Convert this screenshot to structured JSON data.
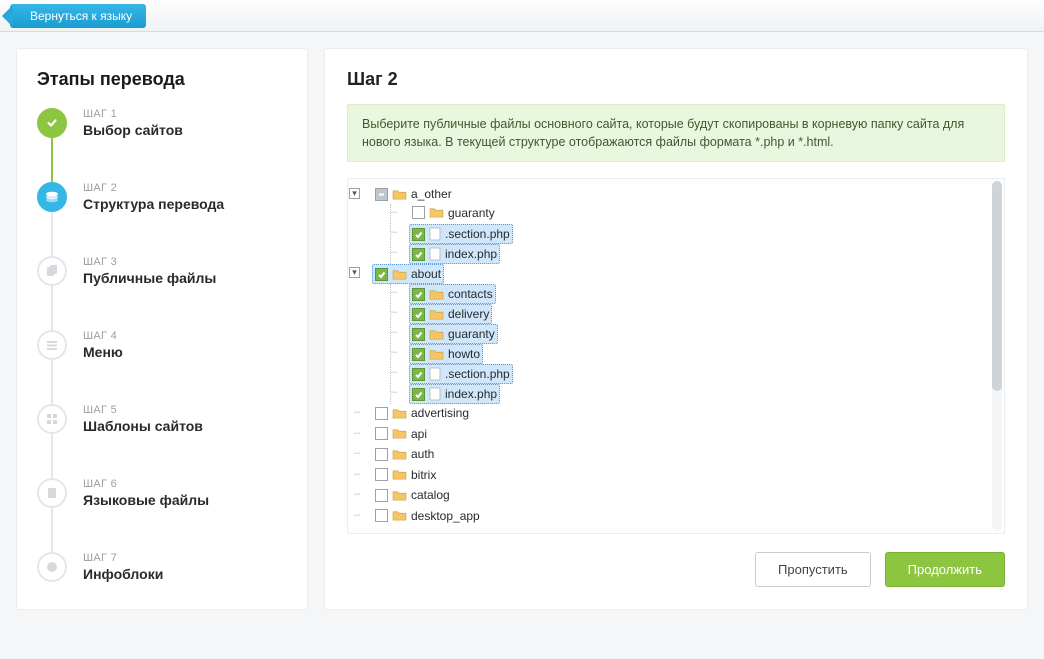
{
  "topbar": {
    "back_label": "Вернуться к языку"
  },
  "sidebar": {
    "title": "Этапы перевода",
    "steps": [
      {
        "kicker": "ШАГ 1",
        "label": "Выбор сайтов"
      },
      {
        "kicker": "ШАГ 2",
        "label": "Структура перевода"
      },
      {
        "kicker": "ШАГ 3",
        "label": "Публичные файлы"
      },
      {
        "kicker": "ШАГ 4",
        "label": "Меню"
      },
      {
        "kicker": "ШАГ 5",
        "label": "Шаблоны сайтов"
      },
      {
        "kicker": "ШАГ 6",
        "label": "Языковые файлы"
      },
      {
        "kicker": "ШАГ 7",
        "label": "Инфоблоки"
      }
    ]
  },
  "main": {
    "title": "Шаг 2",
    "info": "Выберите публичные файлы основного сайта, которые будут скопированы в корневую папку сайта для нового языка. В текущей структуре отображаются файлы формата *.php и *.html.",
    "tree": {
      "a_other": {
        "label": "a_other",
        "state": "mixed",
        "type": "folder",
        "guaranty": {
          "label": "guaranty",
          "state": "unchecked",
          "type": "folder"
        },
        "section_php": {
          "label": ".section.php",
          "state": "checked",
          "type": "file",
          "selected": true
        },
        "index_php": {
          "label": "index.php",
          "state": "checked",
          "type": "file",
          "selected": true
        }
      },
      "about": {
        "label": "about",
        "state": "checked",
        "type": "folder",
        "selected": true,
        "contacts": {
          "label": "contacts",
          "state": "checked",
          "type": "folder",
          "selected": true
        },
        "delivery": {
          "label": "delivery",
          "state": "checked",
          "type": "folder",
          "selected": true
        },
        "guaranty": {
          "label": "guaranty",
          "state": "checked",
          "type": "folder",
          "selected": true
        },
        "howto": {
          "label": "howto",
          "state": "checked",
          "type": "folder",
          "selected": true
        },
        "section_php": {
          "label": ".section.php",
          "state": "checked",
          "type": "file",
          "selected": true
        },
        "index_php": {
          "label": "index.php",
          "state": "checked",
          "type": "file",
          "selected": true
        }
      },
      "advertising": {
        "label": "advertising",
        "state": "unchecked",
        "type": "folder"
      },
      "api": {
        "label": "api",
        "state": "unchecked",
        "type": "folder"
      },
      "auth": {
        "label": "auth",
        "state": "unchecked",
        "type": "folder"
      },
      "bitrix": {
        "label": "bitrix",
        "state": "unchecked",
        "type": "folder"
      },
      "catalog": {
        "label": "catalog",
        "state": "unchecked",
        "type": "folder"
      },
      "desktop_app": {
        "label": "desktop_app",
        "state": "unchecked",
        "type": "folder"
      }
    },
    "buttons": {
      "skip": "Пропустить",
      "continue": "Продолжить"
    }
  }
}
